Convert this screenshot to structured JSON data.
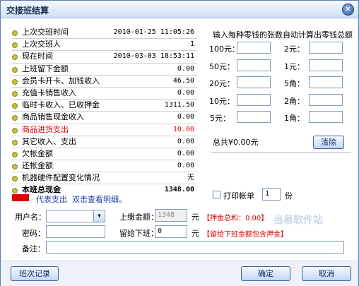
{
  "window": {
    "title": "交接班结算"
  },
  "summary": [
    {
      "label": "上次交班时间",
      "value": "2010-01-25 11:05:26",
      "color": "normal"
    },
    {
      "label": "上次交班人",
      "value": "1",
      "color": "normal"
    },
    {
      "label": "现在时间",
      "value": "2010-03-03 18:53:11",
      "color": "normal"
    },
    {
      "label": "上班留下金额",
      "value": "0.00",
      "color": "normal"
    },
    {
      "label": "会员卡开卡、加钱收入",
      "value": "46.50",
      "color": "normal"
    },
    {
      "label": "充值卡销售收入",
      "value": "0.00",
      "color": "normal"
    },
    {
      "label": "临时卡收入、已收押金",
      "value": "1311.50",
      "color": "normal"
    },
    {
      "label": "商品销售现金收入",
      "value": "0.00",
      "color": "normal"
    },
    {
      "label": "商品进货支出",
      "value": "10.00",
      "color": "red"
    },
    {
      "label": "其它收入、支出",
      "value": "0.00",
      "color": "normal"
    },
    {
      "label": "欠帐金额",
      "value": "0.00",
      "color": "normal"
    },
    {
      "label": "还帐金额",
      "value": "0.00",
      "color": "normal"
    },
    {
      "label": "机器硬件配置变化情况",
      "value": "无",
      "color": "normal"
    },
    {
      "label": "本班总现金",
      "value": "1348.00",
      "color": "bold"
    }
  ],
  "legend": {
    "text1": "代表支出",
    "text2": "双击查看明细。",
    "color": "#e00000"
  },
  "calculator": {
    "title": "输入每种零钱的张数自动计算出零钱总额",
    "left": [
      "100元：",
      "50元：",
      "20元：",
      "10元：",
      "5元："
    ],
    "right": [
      "2元：",
      "1元：",
      "5角：",
      "2角：",
      "1角："
    ],
    "total_label": "总共¥0.00元",
    "clear_button": "清除"
  },
  "print": {
    "label": "打印帐单",
    "copies": "1",
    "unit": "份"
  },
  "form": {
    "username_label": "用户名：",
    "username_value": "",
    "password_label": "密码：",
    "payment_label": "上缴金额：",
    "payment_value": "1348",
    "payment_unit": "元",
    "payment_hint": "【押金总和：0.00】",
    "keep_label": "留给下班：",
    "keep_value": "0",
    "keep_unit": "元",
    "keep_hint": "【留给下班金额包含押金】",
    "note_label": "备注："
  },
  "footer": {
    "records_button": "班次记录",
    "ok_button": "确定",
    "cancel_button": "取消"
  },
  "watermark": {
    "text": "当易软件站"
  }
}
